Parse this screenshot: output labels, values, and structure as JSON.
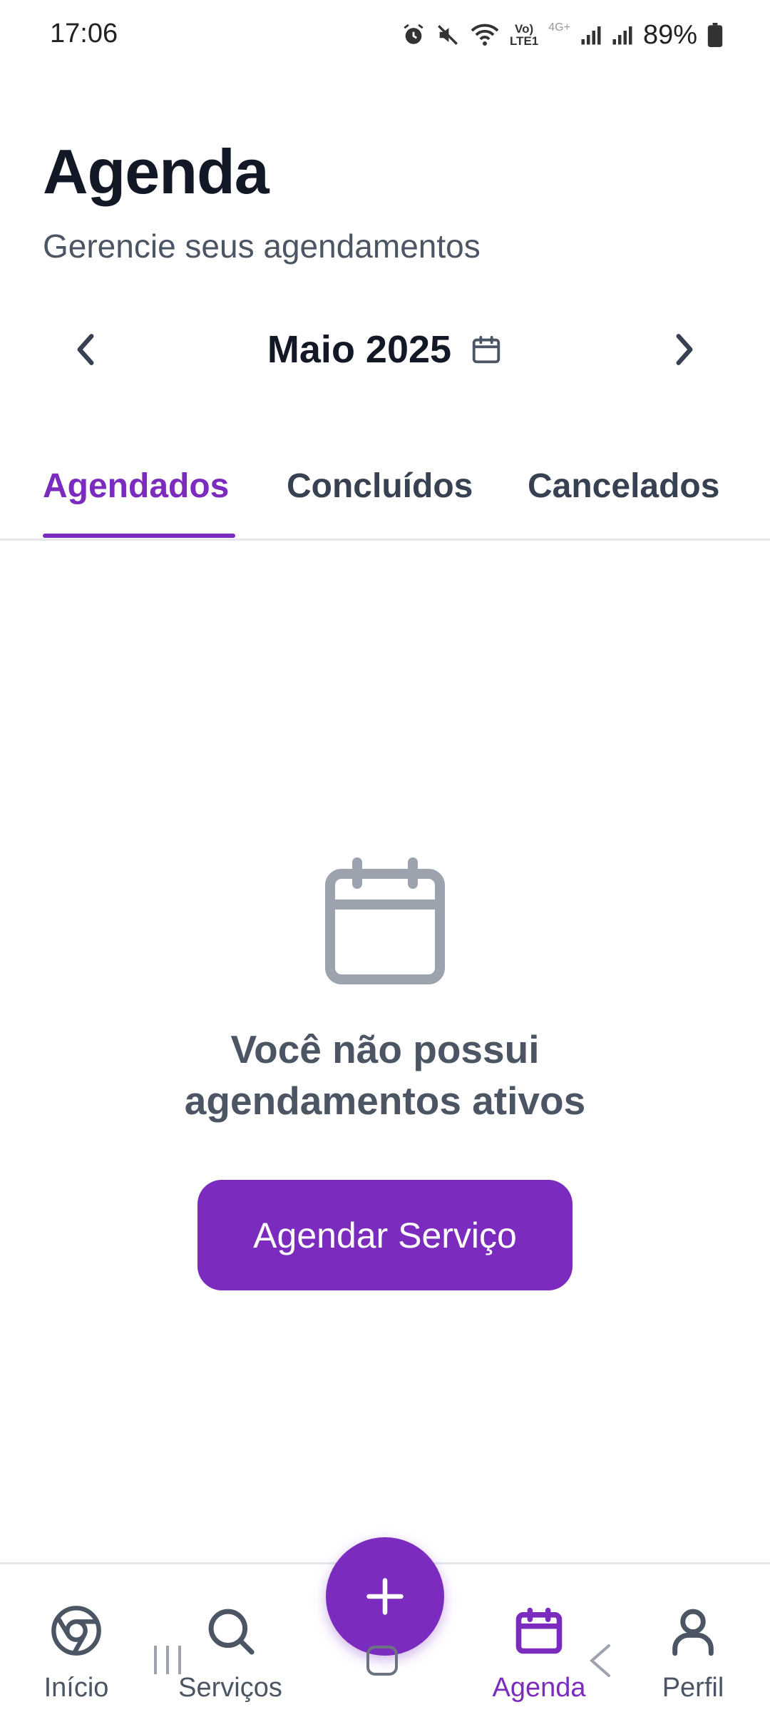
{
  "status_bar": {
    "time": "17:06",
    "network_label_1": "Vo)",
    "network_label_2": "LTE1",
    "network_type": "4G+",
    "battery_percent": "89%"
  },
  "header": {
    "title": "Agenda",
    "subtitle": "Gerencie seus agendamentos"
  },
  "month_selector": {
    "label": "Maio 2025",
    "prev_icon": "chevron-left-icon",
    "next_icon": "chevron-right-icon",
    "calendar_icon": "calendar-icon"
  },
  "tabs": [
    {
      "label": "Agendados",
      "active": true
    },
    {
      "label": "Concluídos",
      "active": false
    },
    {
      "label": "Cancelados",
      "active": false
    }
  ],
  "empty_state": {
    "icon": "calendar-icon",
    "message_line1": "Você não possui",
    "message_line2": "agendamentos ativos",
    "cta_label": "Agendar Serviço"
  },
  "bottom_nav": {
    "items": [
      {
        "label": "Início",
        "icon": "home-chrome-icon",
        "active": false
      },
      {
        "label": "Serviços",
        "icon": "search-icon",
        "active": false
      },
      {
        "label": "Agenda",
        "icon": "calendar-icon",
        "active": true
      },
      {
        "label": "Perfil",
        "icon": "user-icon",
        "active": false
      }
    ],
    "fab_icon": "plus-icon"
  },
  "colors": {
    "accent": "#7b2cbf",
    "title": "#121826",
    "muted": "#4b5563",
    "icon_gray": "#9ca3af"
  }
}
